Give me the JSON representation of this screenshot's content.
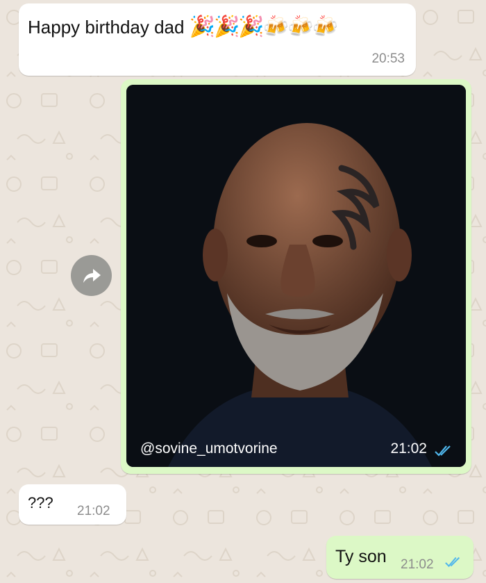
{
  "messages": [
    {
      "id": "m1",
      "direction": "incoming",
      "text": "Happy birthday dad",
      "emojis": "🎉🎉🎉🍻🍻🍻",
      "time": "20:53"
    },
    {
      "id": "m2",
      "direction": "outgoing",
      "type": "image",
      "caption": "@sovine_umotvorine",
      "time": "21:02",
      "status": "read",
      "image_description": "portrait photo of a bald man with grey beard and face tattoo on dark background"
    },
    {
      "id": "m3",
      "direction": "incoming",
      "text": "???",
      "time": "21:02"
    },
    {
      "id": "m4",
      "direction": "outgoing",
      "text": "Ty son",
      "time": "21:02",
      "status": "read"
    }
  ],
  "colors": {
    "background": "#ece5dd",
    "incoming_bubble": "#ffffff",
    "outgoing_bubble": "#dcf8c6",
    "read_tick": "#4fb6ec",
    "forward_button": "#9a9a96"
  },
  "icons": {
    "forward": "forward-arrow-icon",
    "read_receipt": "double-check-icon"
  }
}
